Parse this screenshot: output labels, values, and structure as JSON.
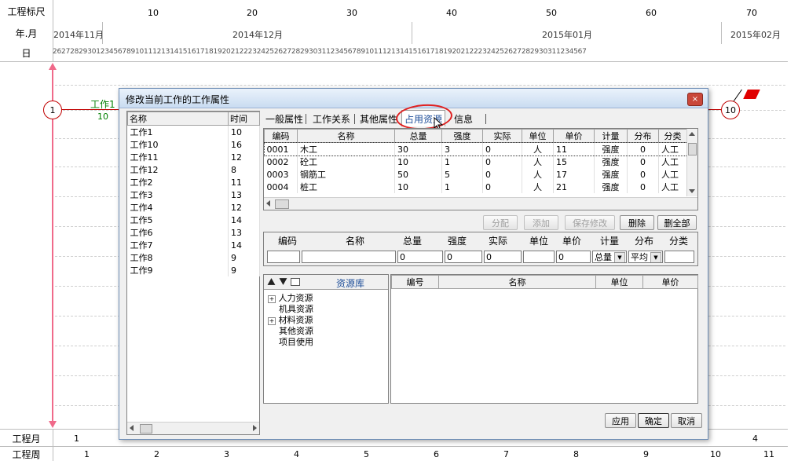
{
  "schedule": {
    "row_labels": {
      "ruler": "工程标尺",
      "month": "年.月",
      "day": "日",
      "project_month": "工程月",
      "project_week": "工程周"
    },
    "ruler_numbers": [
      "10",
      "20",
      "30",
      "40",
      "50",
      "60",
      "70"
    ],
    "months": [
      "2014年11月",
      "2014年12月",
      "2015年01月",
      "2015年02月"
    ],
    "days": "262728293012345678910111213141516171819202122232425262728293031123456789101112131415161718192021222324252627282930311234567",
    "task_label": "工作1",
    "task_duration": "10",
    "start_node": "1",
    "end_node": "10",
    "project_months": [
      "1",
      "4"
    ],
    "project_weeks": [
      "1",
      "2",
      "3",
      "4",
      "5",
      "6",
      "7",
      "8",
      "9",
      "10",
      "11"
    ]
  },
  "dialog": {
    "title": "修改当前工作的工作属性",
    "close": "×",
    "work_list": {
      "headers": [
        "名称",
        "时间"
      ],
      "rows": [
        [
          "工作1",
          "10"
        ],
        [
          "工作10",
          "16"
        ],
        [
          "工作11",
          "12"
        ],
        [
          "工作12",
          "8"
        ],
        [
          "工作2",
          "11"
        ],
        [
          "工作3",
          "13"
        ],
        [
          "工作4",
          "12"
        ],
        [
          "工作5",
          "14"
        ],
        [
          "工作6",
          "13"
        ],
        [
          "工作7",
          "14"
        ],
        [
          "工作8",
          "9"
        ],
        [
          "工作9",
          "9"
        ]
      ]
    },
    "tabs": [
      "一般属性",
      "工作关系",
      "其他属性",
      "占用资源",
      "信息"
    ],
    "resource_table": {
      "headers": [
        "编码",
        "名称",
        "总量",
        "强度",
        "实际",
        "单位",
        "单价",
        "计量",
        "分布",
        "分类"
      ],
      "rows": [
        [
          "0001",
          "木工",
          "30",
          "3",
          "0",
          "人",
          "11",
          "强度",
          "0",
          "人工"
        ],
        [
          "0002",
          "砼工",
          "10",
          "1",
          "0",
          "人",
          "15",
          "强度",
          "0",
          "人工"
        ],
        [
          "0003",
          "钢筋工",
          "50",
          "5",
          "0",
          "人",
          "17",
          "强度",
          "0",
          "人工"
        ],
        [
          "0004",
          "桩工",
          "10",
          "1",
          "0",
          "人",
          "21",
          "强度",
          "0",
          "人工"
        ]
      ]
    },
    "buttons": {
      "assign": "分配",
      "add": "添加",
      "save": "保存修改",
      "delete": "删除",
      "delete_all": "删全部"
    },
    "edit_headers": [
      "编码",
      "名称",
      "总量",
      "强度",
      "实际",
      "单位",
      "单价",
      "计量",
      "分布",
      "分类"
    ],
    "edit_values": {
      "code": "",
      "name": "",
      "total": "0",
      "intensity": "0",
      "actual": "0",
      "unit": "",
      "price": "0",
      "measure": "总量",
      "distribution": "平均"
    },
    "library": {
      "title": "资源库",
      "tree": [
        {
          "label": "人力资源",
          "expand": "+"
        },
        {
          "label": "机具资源",
          "expand": ""
        },
        {
          "label": "材料资源",
          "expand": "+"
        },
        {
          "label": "其他资源",
          "expand": ""
        },
        {
          "label": "项目使用",
          "expand": ""
        }
      ],
      "list_headers": [
        "编号",
        "名称",
        "单位",
        "单价"
      ]
    },
    "footer": {
      "apply": "应用",
      "ok": "确定",
      "cancel": "取消"
    }
  },
  "colors": {
    "accent_green": "#008000",
    "node_red": "#c00000",
    "annotation_red": "#e02020",
    "arrow_pink": "#f06a8a"
  }
}
